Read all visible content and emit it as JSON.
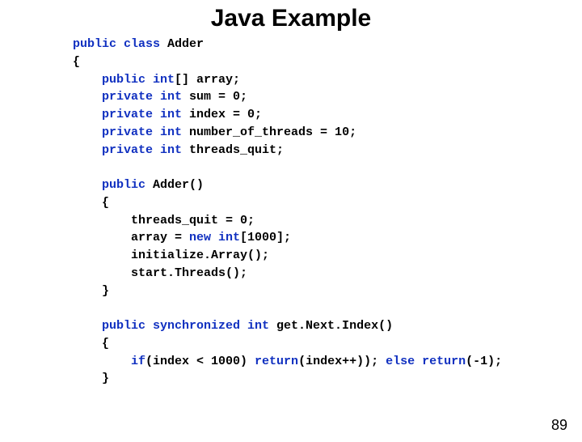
{
  "title": "Java Example",
  "code": {
    "l1a": "public class",
    "l1b": " Adder",
    "l2": "{",
    "l3a": "    public int",
    "l3b": "[] array;",
    "l4a": "    private int",
    "l4b": " sum = 0;",
    "l5a": "    private int",
    "l5b": " index = 0;",
    "l6a": "    private int",
    "l6b": " number_of_threads = 10;",
    "l7a": "    private int",
    "l7b": " threads_quit;",
    "l8": "",
    "l9a": "    public",
    "l9b": " Adder()",
    "l10": "    {",
    "l11": "        threads_quit = 0;",
    "l12a": "        array = ",
    "l12b": "new int",
    "l12c": "[1000];",
    "l13": "        initialize.Array();",
    "l14": "        start.Threads();",
    "l15": "    }",
    "l16": "",
    "l17a": "    public synchronized int",
    "l17b": " get.Next.Index()",
    "l18": "    {",
    "l19a": "        if",
    "l19b": "(index < 1000) ",
    "l19c": "return",
    "l19d": "(index++)); ",
    "l19e": "else return",
    "l19f": "(-1);",
    "l20": "    }"
  },
  "page_number": "89"
}
